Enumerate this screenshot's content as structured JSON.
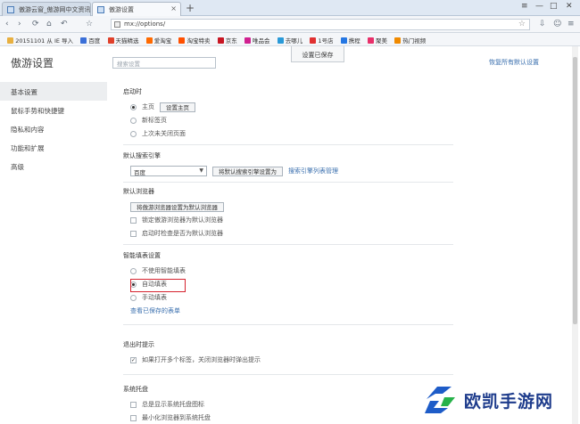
{
  "tabs": [
    {
      "title": "傲游云窗_傲游网中文资讯平台",
      "active": false
    },
    {
      "title": "傲游设置",
      "active": true
    }
  ],
  "new_tab_label": "+",
  "window_controls": [
    "≡",
    "—",
    "□",
    "✕"
  ],
  "nav_icons": [
    "‹",
    "›",
    "⟳",
    "⌂",
    "↶",
    "☆"
  ],
  "address": "mx://options/",
  "bookmarks": [
    {
      "label": "20151101 从 IE 导入",
      "color": "#e8b040"
    },
    {
      "label": "百度",
      "color": "#3a6fd8"
    },
    {
      "label": "天猫精选",
      "color": "#e0402a"
    },
    {
      "label": "爱淘宝",
      "color": "#ff6a00"
    },
    {
      "label": "淘宝特卖",
      "color": "#ff5000"
    },
    {
      "label": "京东",
      "color": "#c81623"
    },
    {
      "label": "唯品会",
      "color": "#d02090"
    },
    {
      "label": "去哪儿",
      "color": "#2a9ad8"
    },
    {
      "label": "1号店",
      "color": "#e03030"
    },
    {
      "label": "携程",
      "color": "#2577e3"
    },
    {
      "label": "聚美",
      "color": "#e8306a"
    },
    {
      "label": "热门视频",
      "color": "#f08a00"
    }
  ],
  "page": {
    "title": "傲游设置",
    "search_placeholder": "搜索设置",
    "saved_label": "设置已保存",
    "restore_link": "恢复所有默认设置"
  },
  "sidebar": [
    {
      "label": "基本设置",
      "selected": true
    },
    {
      "label": "鼠标手势和快捷键",
      "selected": false
    },
    {
      "label": "隐私和内容",
      "selected": false
    },
    {
      "label": "功能和扩展",
      "selected": false
    },
    {
      "label": "高级",
      "selected": false
    }
  ],
  "startup": {
    "heading": "启动时",
    "opt_home": "主页",
    "set_home_button": "设置主页",
    "opt_newtab": "新标签页",
    "opt_last": "上次未关闭页面"
  },
  "search_engine": {
    "heading": "默认搜索引擎",
    "selected": "百度",
    "set_default_button": "将默认搜索引擎设置为",
    "manage_link": "搜索引擎列表管理"
  },
  "default_browser": {
    "heading": "默认浏览器",
    "set_button": "将傲游浏览器设置为默认浏览器",
    "opt_lock": "锁定傲游浏览器为默认浏览器",
    "opt_check": "启动时检查是否为默认浏览器"
  },
  "smart_fill": {
    "heading": "智能填表设置",
    "opt_disable": "不使用智能填表",
    "opt_auto": "自动填表",
    "opt_manual": "手动填表",
    "saved_link": "查看已保存的表单"
  },
  "close_prompt": {
    "heading": "退出时提示",
    "opt_multi": "如果打开多个标签，关闭浏览器时弹出提示"
  },
  "tray": {
    "heading": "系统托盘",
    "opt_show": "总是显示系统托盘图标",
    "opt_minimize": "最小化浏览器到系统托盘"
  },
  "watermark": {
    "text": "欧凯手游网"
  }
}
